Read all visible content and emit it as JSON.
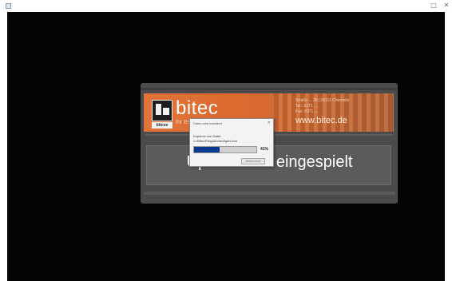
{
  "window": {
    "title_icon": "app-icon",
    "minimize_label": "□",
    "close_label": "✕"
  },
  "banner": {
    "logo_tag": "bitcov",
    "logo_word": "bitec",
    "slogan": "Ihr Em...",
    "contact_line1": "Straße ... 28 | 09111 Chemnitz",
    "contact_line2": "Tel.: 0371 ...",
    "contact_line3": "Fax: 0371 ...",
    "website": "www.bitec.de"
  },
  "status": {
    "text": "Update wird eingespielt"
  },
  "dialog": {
    "title": "Daten wird installiert",
    "close": "✕",
    "line1": "Kopieren von Datei:",
    "line2": "C:\\Bitec\\Programme\\Agent.exe",
    "progress": 41,
    "progress_label": "41%",
    "button": "Abbrechen"
  },
  "colors": {
    "background": "#040404",
    "banner_accent": "#dd6a2f",
    "progress_fill": "#0a3a8e"
  }
}
